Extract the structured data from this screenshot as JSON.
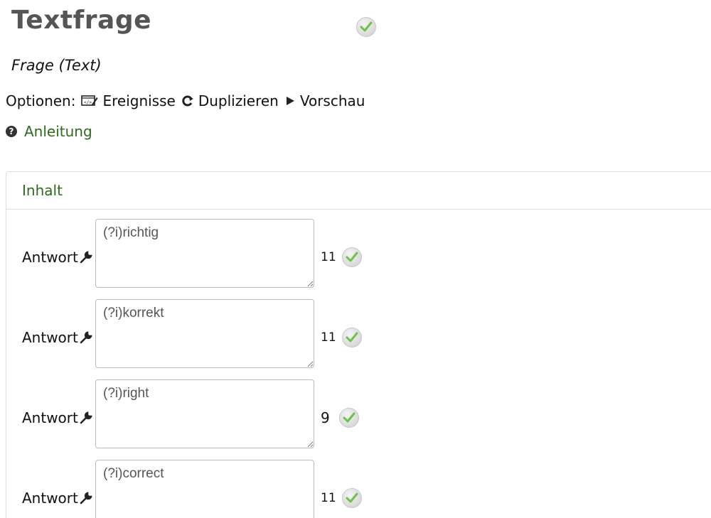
{
  "page": {
    "title": "Textfrage",
    "subtitle": "Frage (Text)"
  },
  "options": {
    "label": "Optionen:",
    "items": [
      {
        "label": "Ereignisse",
        "icon": "edit-code-icon"
      },
      {
        "label": "Duplizieren",
        "icon": "duplicate-icon"
      },
      {
        "label": "Vorschau",
        "icon": "play-icon"
      }
    ]
  },
  "help": {
    "label": "Anleitung",
    "icon": "question-circle-icon"
  },
  "panel": {
    "heading": "Inhalt",
    "answers": [
      {
        "label": "Antwort",
        "value": "(?i)richtig",
        "count": "11",
        "status": "ok"
      },
      {
        "label": "Antwort",
        "value": "(?i)korrekt",
        "count": "11",
        "status": "ok"
      },
      {
        "label": "Antwort",
        "value": "(?i)right",
        "count": "9",
        "status": "ok"
      },
      {
        "label": "Antwort",
        "value": "(?i)correct",
        "count": "11",
        "status": "ok"
      }
    ]
  },
  "colors": {
    "accent_green": "#2e6b1f",
    "check_green": "#6cc24a",
    "title_gray": "#555555"
  }
}
